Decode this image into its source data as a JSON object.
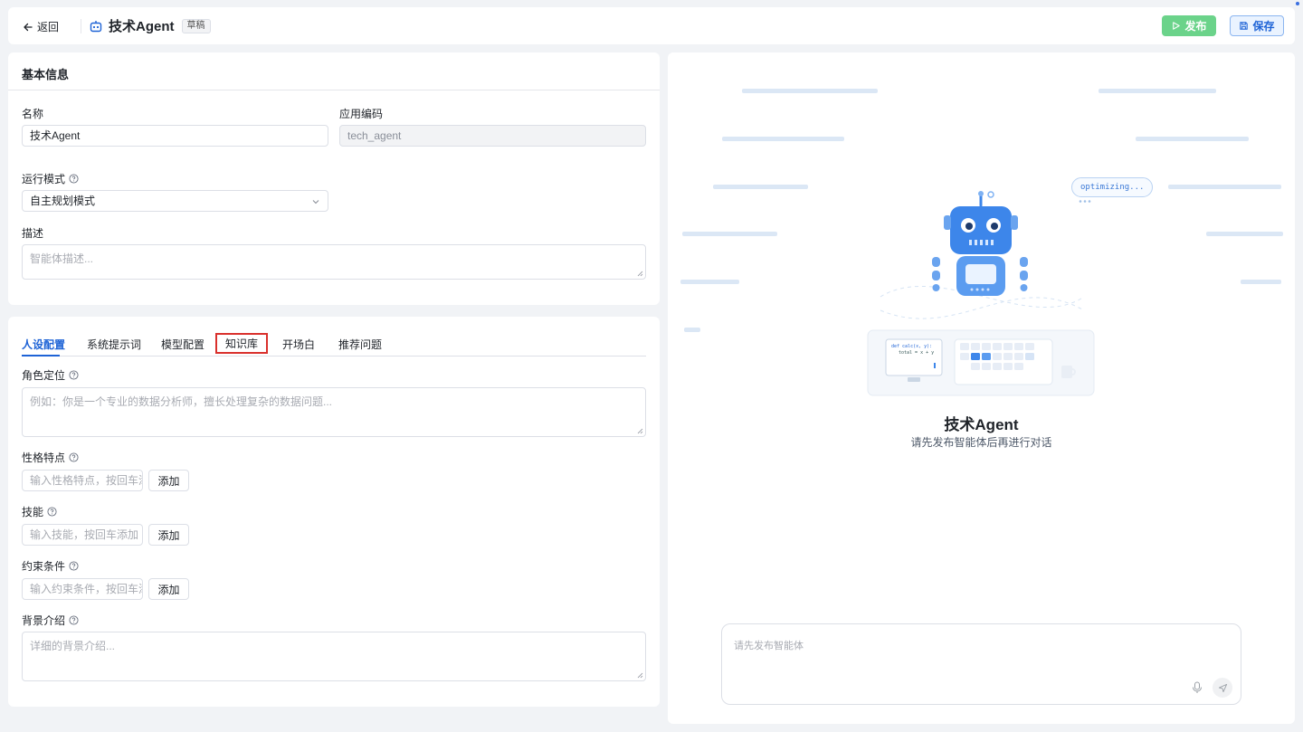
{
  "header": {
    "back_label": "返回",
    "agent_name": "技术Agent",
    "status_badge": "草稿",
    "publish_label": "发布",
    "save_label": "保存"
  },
  "basic_info": {
    "title": "基本信息",
    "name_label": "名称",
    "name_value": "技术Agent",
    "code_label": "应用编码",
    "code_value": "tech_agent",
    "mode_label": "运行模式",
    "mode_value": "自主规划模式",
    "desc_label": "描述",
    "desc_placeholder": "智能体描述..."
  },
  "tabs": [
    {
      "label": "人设配置",
      "active": true
    },
    {
      "label": "系统提示词",
      "active": false
    },
    {
      "label": "模型配置",
      "active": false
    },
    {
      "label": "知识库",
      "active": false
    },
    {
      "label": "开场白",
      "active": false
    },
    {
      "label": "推荐问题",
      "active": false
    }
  ],
  "persona": {
    "role_label": "角色定位",
    "role_placeholder": "例如：你是一个专业的数据分析师，擅长处理复杂的数据问题...",
    "traits_label": "性格特点",
    "traits_placeholder": "输入性格特点，按回车添",
    "skills_label": "技能",
    "skills_placeholder": "输入技能，按回车添加",
    "constraints_label": "约束条件",
    "constraints_placeholder": "输入约束条件，按回车添",
    "background_label": "背景介绍",
    "background_placeholder": "详细的背景介绍...",
    "add_label": "添加"
  },
  "preview": {
    "bubble_text": "optimizing...",
    "title": "技术Agent",
    "subtitle": "请先发布智能体后再进行对话",
    "chat_placeholder": "请先发布智能体",
    "screen_code_line1": "def calc(x, y):",
    "screen_code_line2": "total = x + y"
  },
  "colors": {
    "primary": "#1e63d6",
    "publish_green": "#6bd38a",
    "highlight_red": "#d9302c"
  }
}
